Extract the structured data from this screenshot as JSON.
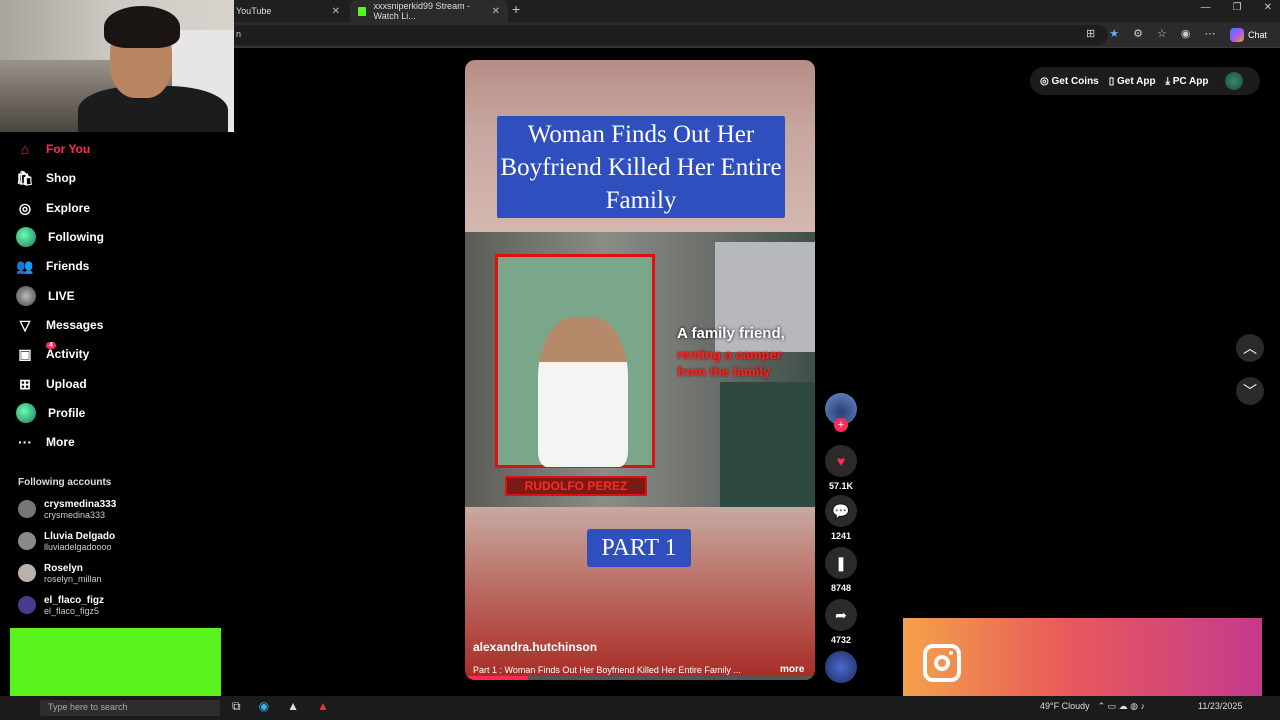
{
  "browser": {
    "tabs": [
      {
        "label": "YouTube"
      },
      {
        "label": "xxxsniperkid99 Stream - Watch Li..."
      }
    ],
    "address_fragment": "n",
    "chat_label": "Chat"
  },
  "sidebar": {
    "nav": [
      {
        "label": "For You",
        "icon": "home-icon"
      },
      {
        "label": "Shop",
        "icon": "shop-icon"
      },
      {
        "label": "Explore",
        "icon": "compass-icon"
      },
      {
        "label": "Following",
        "icon": "following-avatar-icon"
      },
      {
        "label": "Friends",
        "icon": "friends-icon"
      },
      {
        "label": "LIVE",
        "icon": "live-icon"
      },
      {
        "label": "Messages",
        "icon": "send-icon"
      },
      {
        "label": "Activity",
        "icon": "activity-icon",
        "badge": "4"
      },
      {
        "label": "Upload",
        "icon": "upload-icon"
      },
      {
        "label": "Profile",
        "icon": "profile-avatar-icon"
      },
      {
        "label": "More",
        "icon": "more-icon"
      }
    ],
    "following_title": "Following accounts",
    "accounts": [
      {
        "name": "crysmedina333",
        "handle": "crysmedina333"
      },
      {
        "name": "Lluvia Delgado",
        "handle": "lluviadelgadoooo"
      },
      {
        "name": "Roselyn",
        "handle": "roselyn_millan"
      },
      {
        "name": "el_flaco_figz",
        "handle": "el_flaco_figz5"
      }
    ]
  },
  "video": {
    "title_overlay": "Woman Finds Out Her Boyfriend Killed Her Entire Family",
    "name_tag": "RUDOLFO PEREZ",
    "caption_line1": "A family friend,",
    "caption_line2": "renting a camper from the family",
    "part_label": "PART 1",
    "author": "alexandra.hutchinson",
    "description": "Part 1 : Woman Finds Out Her Boyfriend Killed Her Entire Family ...",
    "more_label": "more",
    "progress": 0.18
  },
  "actions": {
    "likes": "57.1K",
    "comments": "1241",
    "saves": "8748",
    "shares": "4732"
  },
  "top_right": {
    "get_coins": "Get Coins",
    "get_app": "Get App",
    "pc_app": "PC App"
  },
  "taskbar": {
    "search_placeholder": "Type here to search",
    "weather": "49°F  Cloudy",
    "date": "11/23/2025"
  }
}
